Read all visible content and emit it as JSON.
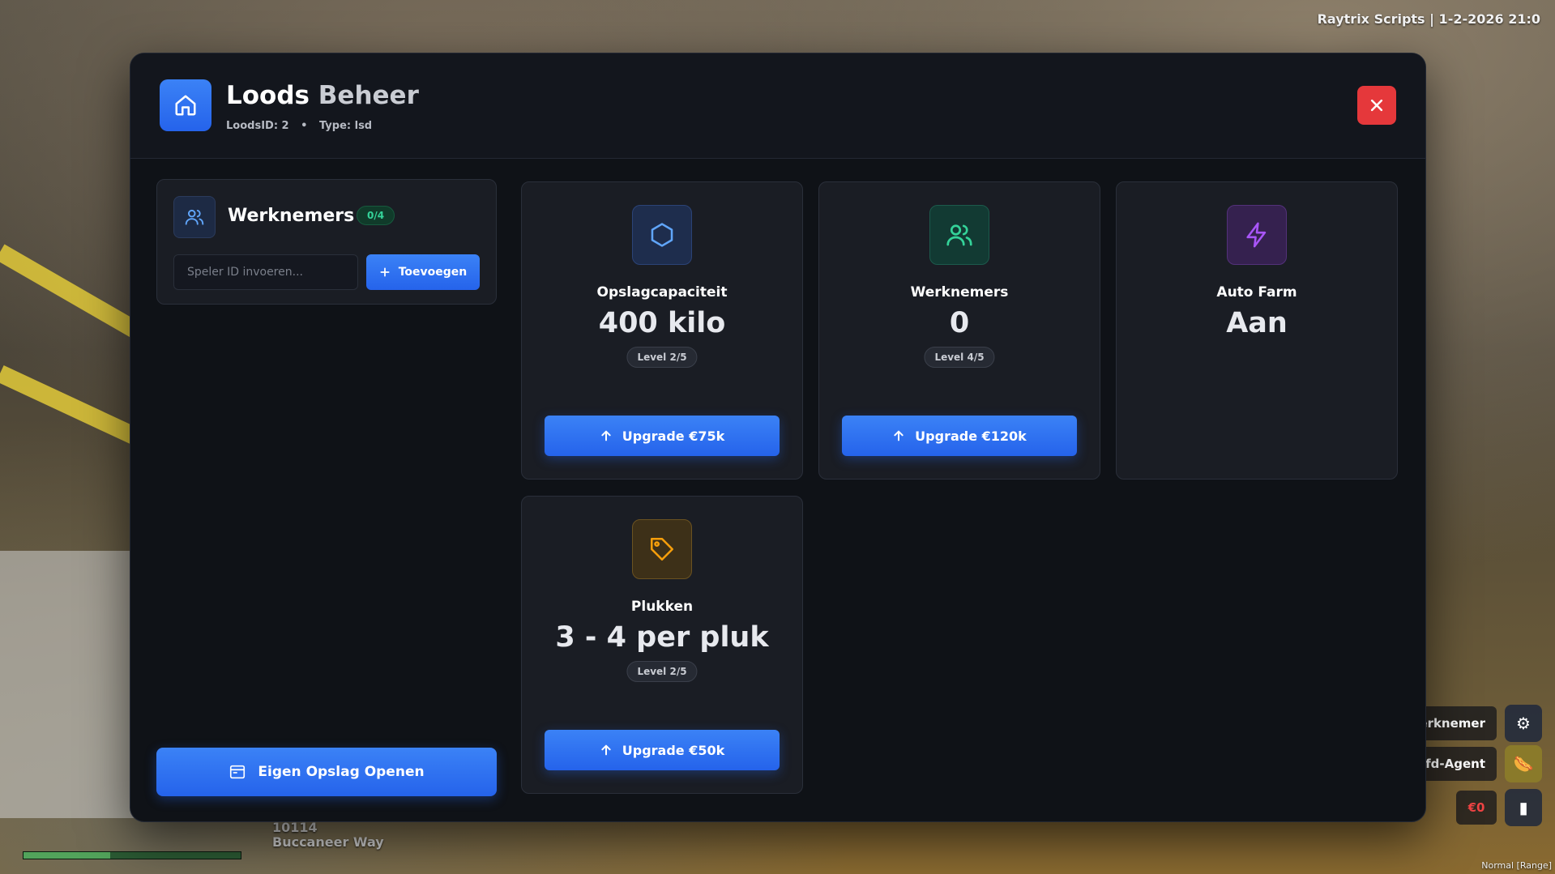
{
  "hud": {
    "top_right": "Raytrix Scripts | 1-2-2026 21:0",
    "street_number": "10114",
    "street_name": "Buccaneer Way",
    "bottom_right": "Normal [Range]",
    "side_chip_1": "erknemer",
    "side_chip_2": "fd-Agent",
    "money": "€0"
  },
  "modal": {
    "title_part1": "Loods",
    "title_part2": "Beheer",
    "loods_id": "LoodsID: 2",
    "type": "Type: lsd",
    "separator": "•"
  },
  "workers_panel": {
    "title": "Werknemers",
    "badge": "0/4",
    "input_placeholder": "Speler ID invoeren...",
    "add_label": "Toevoegen"
  },
  "open_storage_label": "Eigen Opslag Openen",
  "cards": [
    {
      "label": "Opslagcapaciteit",
      "value": "400 kilo",
      "level": "Level 2/5",
      "upgrade": "Upgrade €75k"
    },
    {
      "label": "Werknemers",
      "value": "0",
      "level": "Level 4/5",
      "upgrade": "Upgrade €120k"
    },
    {
      "label": "Auto Farm",
      "value": "Aan"
    },
    {
      "label": "Plukken",
      "value": "3 - 4 per pluk",
      "level": "Level 2/5",
      "upgrade": "Upgrade €50k"
    }
  ],
  "colors": {
    "accent": "#3b82f6",
    "close": "#e5383b",
    "badge_green": "#34d399"
  }
}
